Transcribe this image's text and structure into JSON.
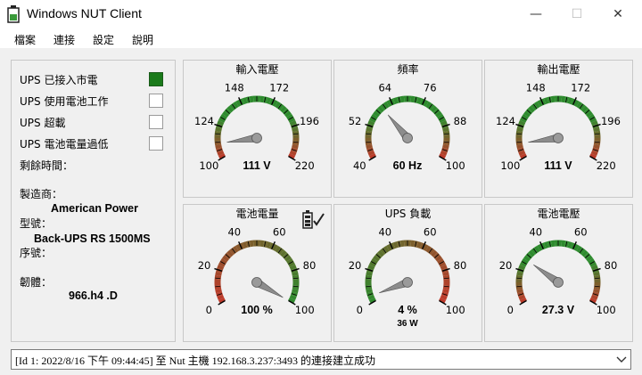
{
  "window": {
    "title": "Windows NUT Client",
    "minimize": "—",
    "maximize": "☐",
    "close": "✕"
  },
  "menu": [
    "檔案",
    "連接",
    "設定",
    "說明"
  ],
  "status_flags": [
    {
      "label": "UPS 已接入市電",
      "checked": true
    },
    {
      "label": "UPS 使用電池工作",
      "checked": false
    },
    {
      "label": "UPS 超載",
      "checked": false
    },
    {
      "label": "UPS 電池電量過低",
      "checked": false
    }
  ],
  "info": {
    "runtime_label": "剩餘時間：",
    "manufacturer_label": "製造商：",
    "manufacturer": "American Power",
    "model_label": "型號：",
    "model": "Back-UPS RS 1500MS",
    "serial_label": "序號：",
    "firmware_label": "韌體：",
    "firmware": "966.h4 .D"
  },
  "gauges": [
    {
      "title": "輸入電壓",
      "ticks": [
        "100",
        "124",
        "148",
        "172",
        "196",
        "220"
      ],
      "readout": "111 V",
      "min": 100,
      "max": 220,
      "value": 111,
      "scheme": "mid-green",
      "sub": ""
    },
    {
      "title": "頻率",
      "ticks": [
        "40",
        "52",
        "64",
        "76",
        "88",
        "100"
      ],
      "readout": "60 Hz",
      "min": 40,
      "max": 100,
      "value": 60,
      "scheme": "mid-green",
      "sub": ""
    },
    {
      "title": "輸出電壓",
      "ticks": [
        "100",
        "124",
        "148",
        "172",
        "196",
        "220"
      ],
      "readout": "111 V",
      "min": 100,
      "max": 220,
      "value": 111,
      "scheme": "mid-green",
      "sub": ""
    },
    {
      "title": "電池電量",
      "ticks": [
        "0",
        "20",
        "40",
        "60",
        "80",
        "100"
      ],
      "readout": "100 %",
      "min": 0,
      "max": 100,
      "value": 100,
      "scheme": "red-to-green",
      "sub": ""
    },
    {
      "title": "UPS 負載",
      "ticks": [
        "0",
        "20",
        "40",
        "60",
        "80",
        "100"
      ],
      "readout": "4 %",
      "min": 0,
      "max": 100,
      "value": 4,
      "scheme": "green-to-red",
      "sub": "36 W"
    },
    {
      "title": "電池電壓",
      "ticks": [
        "0",
        "20",
        "40",
        "60",
        "80",
        "100"
      ],
      "readout": "27.3 V",
      "min": 0,
      "max": 100,
      "value": 27.3,
      "scheme": "mid-green",
      "sub": ""
    }
  ],
  "status_bar": {
    "text": "[Id 1: 2022/8/16 下午 09:44:45] 至 Nut 主機 192.168.3.237:3493 的連接建立成功"
  },
  "colors": {
    "red": "#c0392b",
    "green": "#2e8b2e",
    "online": "#1a7a1a"
  }
}
